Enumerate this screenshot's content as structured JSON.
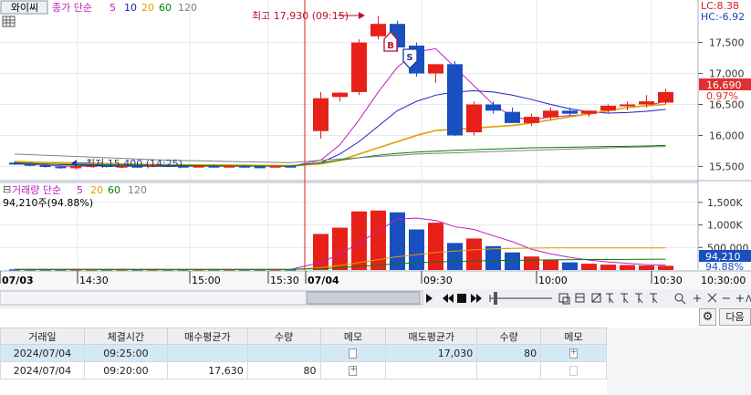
{
  "price_header": {
    "stock_name": "와이씨",
    "ma_title": "종가 단순",
    "periods": [
      "5",
      "10",
      "20",
      "60",
      "120"
    ],
    "period_colors": [
      "#c020c0",
      "#2020c0",
      "#e0a000",
      "#008000",
      "#808080"
    ]
  },
  "lc_label": "LC:8.38",
  "hc_label": "HC:-6.92",
  "high_annotation": "최고 17,930 (09:15)",
  "low_annotation": "최저 15,400 (14:25)",
  "buy_marker": "B",
  "sell_marker": "S",
  "current_price": "16,690",
  "current_change": "0.97%",
  "price_ticks": [
    "17,500",
    "17,000",
    "16,500",
    "16,000",
    "15,500"
  ],
  "volume_header": {
    "title": "거래량 단순",
    "periods": [
      "5",
      "20",
      "60",
      "120"
    ],
    "period_colors": [
      "#c020c0",
      "#e0a000",
      "#008000",
      "#808080"
    ],
    "current": "94,210주(94.88%)"
  },
  "volume_ticks": [
    "1,500K",
    "1,000K",
    "500,000"
  ],
  "current_volume": "94,210",
  "current_volume_pct": "94.88%",
  "time_axis": {
    "labels": [
      "07/03",
      "14:30",
      "15:00",
      "15:30",
      "07/04",
      "09:30",
      "10:00",
      "10:30",
      "10:30:00"
    ]
  },
  "table": {
    "headers": [
      "거래일",
      "체결시간",
      "매수평균가",
      "수량",
      "메모",
      "매도평균가",
      "수량",
      "메모"
    ],
    "rows": [
      {
        "date": "2024/07/04",
        "time": "09:25:00",
        "buy_avg": "",
        "buy_qty": "",
        "sell_avg": "17,030",
        "sell_qty": "80"
      },
      {
        "date": "2024/07/04",
        "time": "09:20:00",
        "buy_avg": "17,630",
        "buy_qty": "80",
        "sell_avg": "",
        "sell_qty": ""
      }
    ]
  },
  "next_button": "다음",
  "chart_data": {
    "type": "candlestick",
    "price_axis": {
      "ylim": [
        15300,
        17950
      ],
      "ticks": [
        17500,
        17000,
        16500,
        16000,
        15500
      ]
    },
    "candles": [
      {
        "o": 15560,
        "h": 15580,
        "l": 15520,
        "c": 15540
      },
      {
        "o": 15540,
        "h": 15560,
        "l": 15500,
        "c": 15520
      },
      {
        "o": 15520,
        "h": 15540,
        "l": 15480,
        "c": 15500
      },
      {
        "o": 15500,
        "h": 15520,
        "l": 15460,
        "c": 15480
      },
      {
        "o": 15480,
        "h": 15520,
        "l": 15450,
        "c": 15500
      },
      {
        "o": 15500,
        "h": 15540,
        "l": 15480,
        "c": 15520
      },
      {
        "o": 15520,
        "h": 15540,
        "l": 15480,
        "c": 15500
      },
      {
        "o": 15500,
        "h": 15530,
        "l": 15470,
        "c": 15510
      },
      {
        "o": 15510,
        "h": 15530,
        "l": 15480,
        "c": 15500
      },
      {
        "o": 15500,
        "h": 15540,
        "l": 15490,
        "c": 15520
      },
      {
        "o": 15520,
        "h": 15540,
        "l": 15490,
        "c": 15510
      },
      {
        "o": 15510,
        "h": 15530,
        "l": 15480,
        "c": 15500
      },
      {
        "o": 15500,
        "h": 15520,
        "l": 15490,
        "c": 15510
      },
      {
        "o": 15510,
        "h": 15530,
        "l": 15480,
        "c": 15500
      },
      {
        "o": 15500,
        "h": 15530,
        "l": 15490,
        "c": 15510
      },
      {
        "o": 15510,
        "h": 15530,
        "l": 15480,
        "c": 15500
      },
      {
        "o": 15500,
        "h": 15520,
        "l": 15480,
        "c": 15490
      },
      {
        "o": 15490,
        "h": 15520,
        "l": 15480,
        "c": 15510
      },
      {
        "o": 15510,
        "h": 15520,
        "l": 15490,
        "c": 15500
      },
      {
        "o": 16070,
        "h": 16700,
        "l": 15950,
        "c": 16600
      },
      {
        "o": 16620,
        "h": 16700,
        "l": 16550,
        "c": 16690
      },
      {
        "o": 16700,
        "h": 17550,
        "l": 16650,
        "c": 17500
      },
      {
        "o": 17600,
        "h": 17930,
        "l": 17550,
        "c": 17800
      },
      {
        "o": 17800,
        "h": 17850,
        "l": 17350,
        "c": 17420
      },
      {
        "o": 17450,
        "h": 17500,
        "l": 16950,
        "c": 17000
      },
      {
        "o": 17000,
        "h": 17150,
        "l": 16850,
        "c": 17150
      },
      {
        "o": 17150,
        "h": 17200,
        "l": 15990,
        "c": 16000
      },
      {
        "o": 16050,
        "h": 16550,
        "l": 16000,
        "c": 16500
      },
      {
        "o": 16500,
        "h": 16550,
        "l": 16350,
        "c": 16400
      },
      {
        "o": 16380,
        "h": 16450,
        "l": 16200,
        "c": 16200
      },
      {
        "o": 16200,
        "h": 16350,
        "l": 16150,
        "c": 16300
      },
      {
        "o": 16290,
        "h": 16450,
        "l": 16250,
        "c": 16400
      },
      {
        "o": 16400,
        "h": 16450,
        "l": 16320,
        "c": 16350
      },
      {
        "o": 16350,
        "h": 16400,
        "l": 16300,
        "c": 16400
      },
      {
        "o": 16400,
        "h": 16500,
        "l": 16350,
        "c": 16480
      },
      {
        "o": 16480,
        "h": 16550,
        "l": 16400,
        "c": 16500
      },
      {
        "o": 16500,
        "h": 16650,
        "l": 16450,
        "c": 16550
      },
      {
        "o": 16530,
        "h": 16750,
        "l": 16500,
        "c": 16700
      }
    ],
    "volume_axis": {
      "ylim": [
        0,
        1700000
      ],
      "ticks": [
        1500000,
        1000000,
        500000
      ]
    },
    "volumes": [
      15000,
      10000,
      18000,
      12000,
      16000,
      14000,
      11000,
      15000,
      12000,
      13000,
      11000,
      14000,
      12000,
      13000,
      15000,
      11000,
      12000,
      14000,
      13000,
      800000,
      940000,
      1300000,
      1320000,
      1280000,
      900000,
      1050000,
      600000,
      700000,
      530000,
      390000,
      300000,
      230000,
      170000,
      140000,
      120000,
      110000,
      100000,
      94210
    ],
    "ma_lines": [
      {
        "name": "5",
        "values": [
          15540,
          15530,
          15520,
          15510,
          15500,
          15510,
          15505,
          15505,
          15505,
          15505,
          15505,
          15505,
          15505,
          15505,
          15505,
          15505,
          15505,
          15505,
          15500,
          15600,
          15850,
          16250,
          16700,
          17100,
          17350,
          17400,
          17100,
          16800,
          16500,
          16300,
          16250,
          16300,
          16320,
          16340,
          16400,
          16450,
          16480,
          16550
        ]
      },
      {
        "name": "10",
        "values": [
          15560,
          15550,
          15540,
          15530,
          15520,
          15515,
          15512,
          15510,
          15510,
          15508,
          15507,
          15506,
          15506,
          15506,
          15506,
          15506,
          15506,
          15506,
          15505,
          15560,
          15700,
          15900,
          16150,
          16400,
          16550,
          16650,
          16700,
          16720,
          16700,
          16650,
          16580,
          16500,
          16430,
          16380,
          16360,
          16370,
          16390,
          16420
        ]
      },
      {
        "name": "20",
        "values": [
          15580,
          15570,
          15565,
          15560,
          15555,
          15550,
          15545,
          15540,
          15535,
          15530,
          15528,
          15526,
          15524,
          15522,
          15520,
          15518,
          15516,
          15514,
          15512,
          15540,
          15600,
          15700,
          15800,
          15900,
          16000,
          16080,
          16100,
          16120,
          16140,
          16160,
          16200,
          16250,
          16300,
          16350,
          16400,
          16450,
          16480,
          16500
        ]
      },
      {
        "name": "60",
        "values": [
          15550,
          15545,
          15540,
          15535,
          15530,
          15528,
          15526,
          15524,
          15522,
          15520,
          15518,
          15516,
          15514,
          15512,
          15510,
          15508,
          15506,
          15504,
          15502,
          15560,
          15600,
          15640,
          15680,
          15710,
          15730,
          15745,
          15760,
          15770,
          15780,
          15790,
          15800,
          15805,
          15810,
          15815,
          15820,
          15825,
          15830,
          15840
        ]
      },
      {
        "name": "120",
        "values": [
          15700,
          15690,
          15680,
          15670,
          15660,
          15650,
          15640,
          15630,
          15620,
          15610,
          15600,
          15595,
          15590,
          15585,
          15580,
          15575,
          15570,
          15565,
          15560,
          15600,
          15620,
          15640,
          15660,
          15680,
          15700,
          15710,
          15720,
          15730,
          15740,
          15750,
          15760,
          15770,
          15780,
          15790,
          15800,
          15810,
          15815,
          15820
        ]
      }
    ],
    "volume_ma_lines": [
      {
        "name": "5",
        "values": [
          14000,
          13000,
          14000,
          13500,
          14000,
          14000,
          13500,
          14000,
          13500,
          13000,
          13000,
          13000,
          13000,
          13000,
          13000,
          13000,
          13000,
          13000,
          13000,
          170000,
          350000,
          600000,
          870000,
          1130000,
          1150000,
          1100000,
          960000,
          900000,
          760000,
          630000,
          460000,
          360000,
          280000,
          220000,
          180000,
          150000,
          120000,
          110000
        ]
      },
      {
        "name": "20",
        "values": [
          14000,
          14000,
          14000,
          14000,
          14000,
          14000,
          14000,
          14000,
          14000,
          14000,
          13000,
          13000,
          13000,
          13000,
          13000,
          13000,
          13000,
          13000,
          13000,
          52000,
          100000,
          165000,
          230000,
          295000,
          340000,
          390000,
          420000,
          450000,
          470000,
          480000,
          485000,
          490000,
          490000,
          490000,
          490000,
          490000,
          490000,
          490000
        ]
      },
      {
        "name": "60",
        "values": [
          14000,
          14000,
          14000,
          14000,
          14000,
          14000,
          14000,
          14000,
          14000,
          14000,
          14000,
          14000,
          14000,
          14000,
          14000,
          14000,
          14000,
          14000,
          14000,
          30000,
          50000,
          80000,
          110000,
          140000,
          160000,
          180000,
          190000,
          200000,
          210000,
          215000,
          220000,
          225000,
          230000,
          232000,
          234000,
          236000,
          238000,
          240000
        ]
      }
    ]
  }
}
